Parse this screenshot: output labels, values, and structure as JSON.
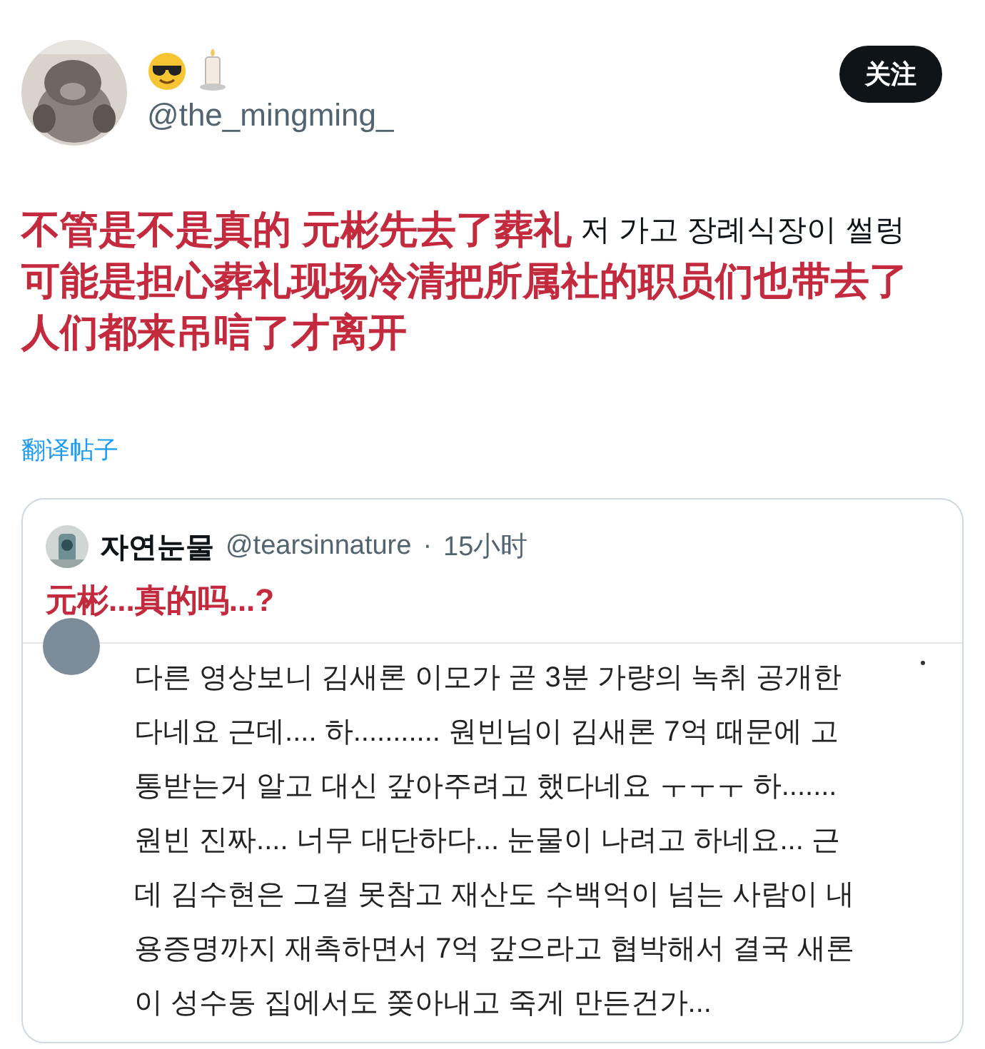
{
  "author": {
    "handle": "@the_mingming_"
  },
  "follow_button": "关注",
  "post": {
    "lines": [
      {
        "overlay": "不管是不是真的 元彬先去了葬礼",
        "visible": "저 가고 장례식장이 썰렁"
      },
      {
        "overlay": "可能是担心葬礼现场冷清把所属社的职员们也带去了"
      },
      {
        "overlay": "人们都来吊唁了才离开"
      }
    ]
  },
  "translate_link": "翻译帖子",
  "quote": {
    "name": "자연눈물",
    "handle": "@tearsinnature",
    "separator": "·",
    "time": "15小时",
    "overlay": "元彬...真的吗...?",
    "screenshot_lines": [
      "다른 영상보니 김새론 이모가 곧 3분 가량의 녹취 공개한",
      "다네요 근데.... 하........... 원빈님이 김새론 7억 때문에 고",
      "통받는거 알고 대신 갚아주려고 했다네요 ㅜㅜㅜ 하.......",
      "원빈 진짜.... 너무 대단하다... 눈물이 나려고 하네요... 근",
      "데 김수현은 그걸 못참고 재산도 수백억이 넘는 사람이 내",
      "용증명까지 재촉하면서 7억 갚으라고 협박해서 결국 새론",
      "이 성수동 집에서도 쫒아내고 죽게 만든건가..."
    ]
  }
}
